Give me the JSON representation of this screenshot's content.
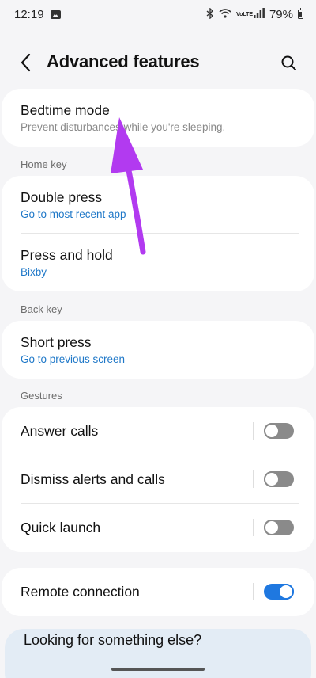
{
  "status_bar": {
    "time": "12:19",
    "volte": "VoLTE",
    "battery": "79%"
  },
  "app_bar": {
    "title": "Advanced features",
    "icons": [
      "back-arrow-icon",
      "search-icon"
    ]
  },
  "bedtime": {
    "title": "Bedtime mode",
    "subtitle": "Prevent disturbances while you're sleeping."
  },
  "home_key": {
    "header": "Home key",
    "items": [
      {
        "title": "Double press",
        "value": "Go to most recent app"
      },
      {
        "title": "Press and hold",
        "value": "Bixby"
      }
    ]
  },
  "back_key": {
    "header": "Back key",
    "items": [
      {
        "title": "Short press",
        "value": "Go to previous screen"
      }
    ]
  },
  "gestures": {
    "header": "Gestures",
    "items": [
      {
        "title": "Answer calls",
        "enabled": false
      },
      {
        "title": "Dismiss alerts and calls",
        "enabled": false
      },
      {
        "title": "Quick launch",
        "enabled": false
      }
    ]
  },
  "remote": {
    "title": "Remote connection",
    "enabled": true
  },
  "suggestion": {
    "text": "Looking for something else?"
  },
  "colors": {
    "accent": "#1f78e0",
    "link_blue": "#1f78c8",
    "annotation_arrow": "#b23af0"
  }
}
